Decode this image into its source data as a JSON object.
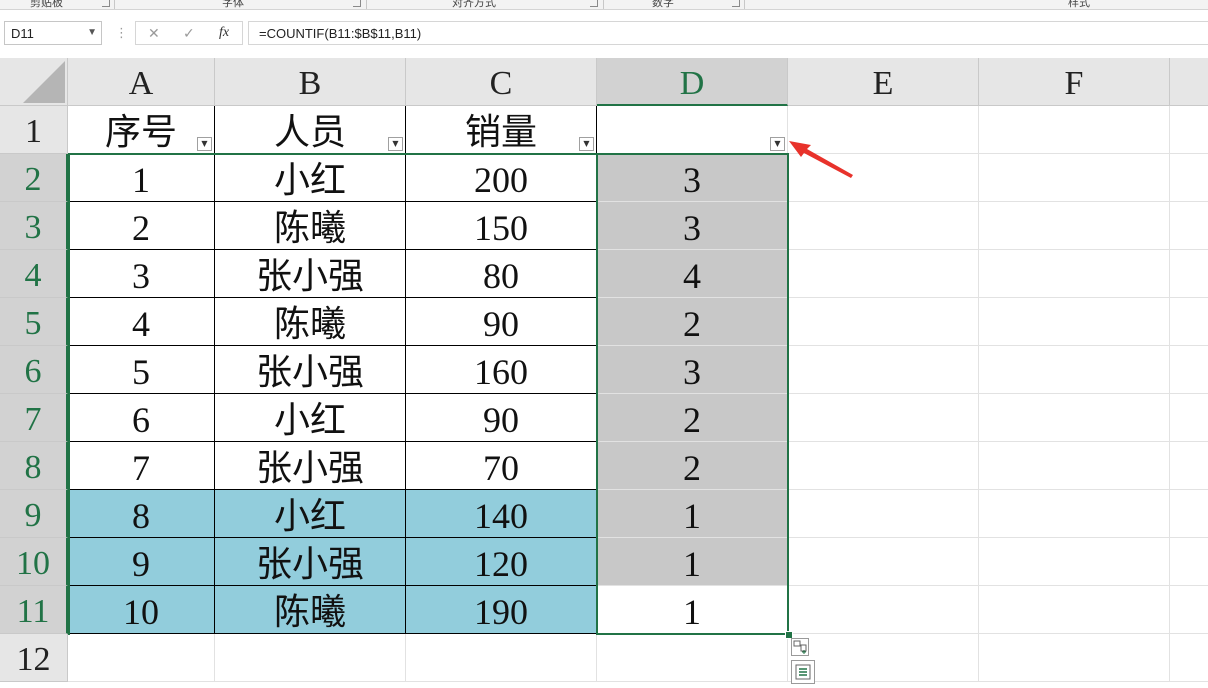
{
  "ribbon": {
    "groups": [
      "剪贴板",
      "字体",
      "对齐方式",
      "数字",
      "样式"
    ]
  },
  "formula_bar": {
    "name_box": "D11",
    "dots": "⋮",
    "cancel": "✕",
    "enter": "✓",
    "fx": "fx",
    "formula": "=COUNTIF(B11:$B$11,B11)"
  },
  "columns": [
    "A",
    "B",
    "C",
    "D",
    "E",
    "F"
  ],
  "rows": [
    "1",
    "2",
    "3",
    "4",
    "5",
    "6",
    "7",
    "8",
    "9",
    "10",
    "11",
    "12"
  ],
  "headers": [
    "序号",
    "人员",
    "销量",
    ""
  ],
  "data": [
    {
      "a": "1",
      "b": "小红",
      "c": "200",
      "d": "3"
    },
    {
      "a": "2",
      "b": "陈曦",
      "c": "150",
      "d": "3"
    },
    {
      "a": "3",
      "b": "张小强",
      "c": "80",
      "d": "4"
    },
    {
      "a": "4",
      "b": "陈曦",
      "c": "90",
      "d": "2"
    },
    {
      "a": "5",
      "b": "张小强",
      "c": "160",
      "d": "3"
    },
    {
      "a": "6",
      "b": "小红",
      "c": "90",
      "d": "2"
    },
    {
      "a": "7",
      "b": "张小强",
      "c": "70",
      "d": "2"
    },
    {
      "a": "8",
      "b": "小红",
      "c": "140",
      "d": "1"
    },
    {
      "a": "9",
      "b": "张小强",
      "c": "120",
      "d": "1"
    },
    {
      "a": "10",
      "b": "陈曦",
      "c": "190",
      "d": "1"
    }
  ],
  "colors": {
    "accent_green": "#217346",
    "highlight_blue": "#92cddc",
    "selection_gray": "#c8c8c8",
    "arrow_red": "#e8322b"
  }
}
